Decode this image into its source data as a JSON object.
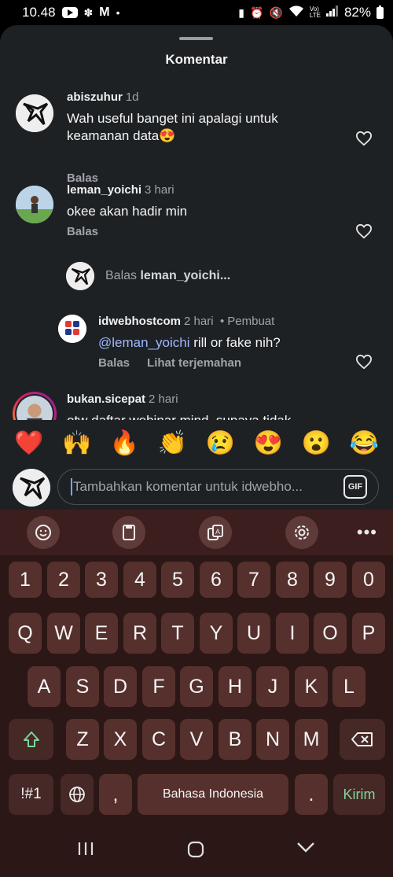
{
  "status": {
    "time": "10.48",
    "battery": "82%"
  },
  "sheet": {
    "title": "Komentar"
  },
  "comments": [
    {
      "username": "abiszuhur",
      "time": "1d",
      "text_line1": "Wah useful banget ini apalagi untuk",
      "text_line2": "keamanan data😍",
      "reply_label": "Balas"
    },
    {
      "username": "leman_yoichi",
      "time": "3 hari",
      "text": "okee akan hadir min",
      "reply_label": "Balas"
    }
  ],
  "reply_prompt": {
    "prefix": "Balas",
    "target": "leman_yoichi..."
  },
  "reply": {
    "username": "idwebhostcom",
    "time": "2 hari",
    "separator": "•",
    "role": "Pembuat",
    "mention": "@leman_yoichi",
    "text": " rill or fake nih?",
    "reply_label": "Balas",
    "translate_label": "Lihat terjemahan"
  },
  "partial_comment": {
    "username": "bukan.sicepat",
    "time": "2 hari",
    "text": "otw daftar webinar mind, supaya tidak"
  },
  "emoji_reactions": [
    "❤️",
    "🙌",
    "🔥",
    "👏",
    "😢",
    "😍",
    "😮",
    "😂"
  ],
  "comment_input": {
    "placeholder": "Tambahkan komentar untuk idwebho...",
    "gif_label": "GIF"
  },
  "keyboard": {
    "toolbar_more": "•••",
    "row_numbers": [
      "1",
      "2",
      "3",
      "4",
      "5",
      "6",
      "7",
      "8",
      "9",
      "0"
    ],
    "row_top": [
      "Q",
      "W",
      "E",
      "R",
      "T",
      "Y",
      "U",
      "I",
      "O",
      "P"
    ],
    "row_middle": [
      "A",
      "S",
      "D",
      "F",
      "G",
      "H",
      "J",
      "K",
      "L"
    ],
    "row_bottom": [
      "Z",
      "X",
      "C",
      "V",
      "B",
      "N",
      "M"
    ],
    "symbols_label": "!#1",
    "comma_label": ",",
    "space_label": "Bahasa Indonesia",
    "period_label": ".",
    "send_label": "Kirim"
  },
  "colors": {
    "sheet_bg": "#1e2124",
    "keyboard_bg": "#2b1716",
    "key_bg": "#56302d",
    "mention": "#9eb7ff",
    "send_text": "#7ed69a"
  }
}
